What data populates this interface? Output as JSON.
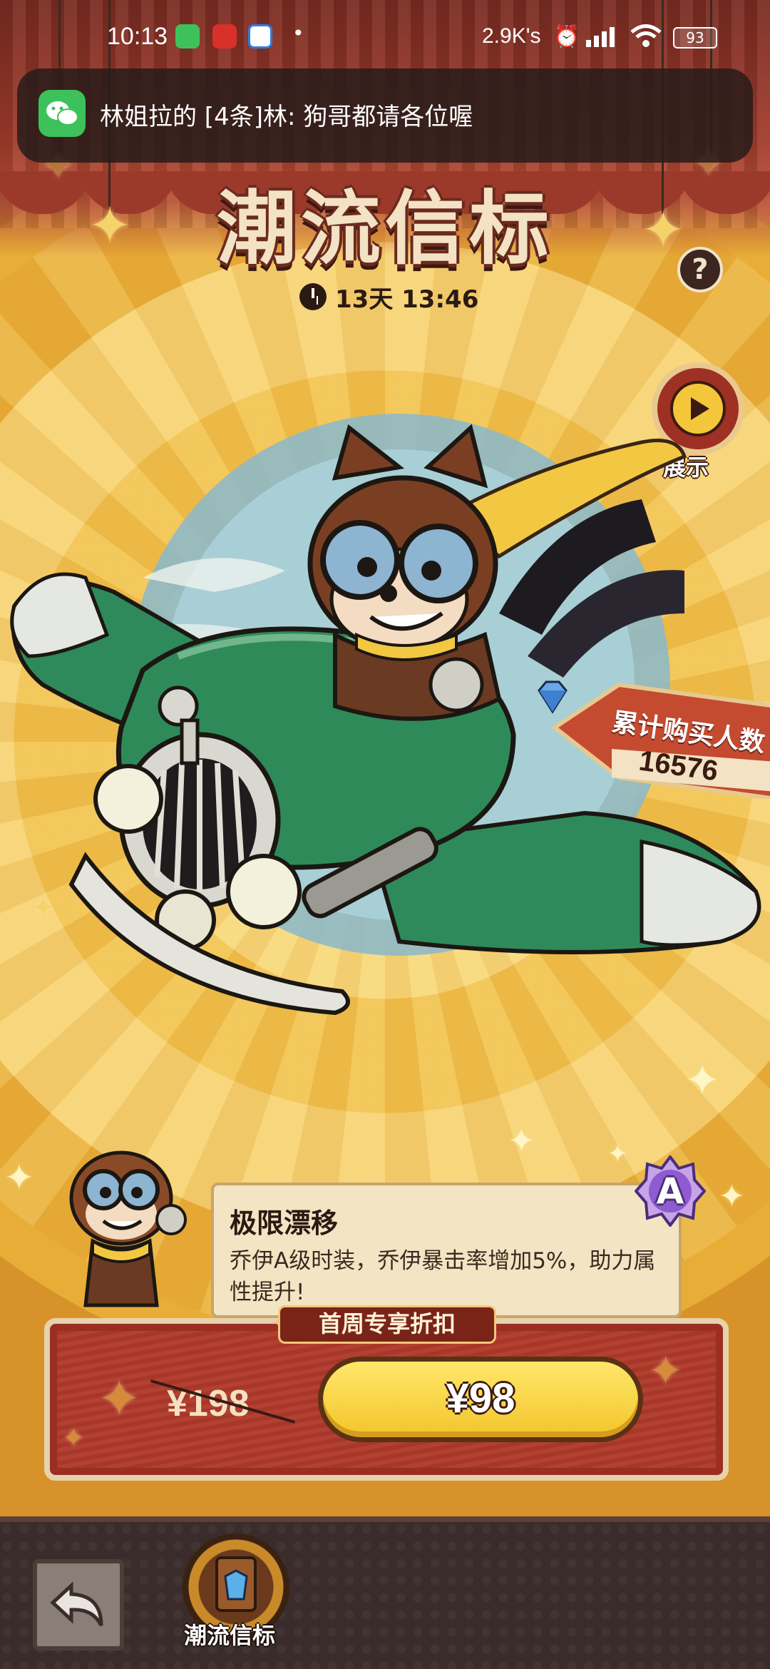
{
  "status_bar": {
    "time": "10:13",
    "dot": "•",
    "network_speed": "2.9K's",
    "battery": "93",
    "icons": [
      "wechat-icon",
      "red-app-icon",
      "qq-browser-icon",
      "alarm-icon",
      "signal-icon",
      "wifi-icon"
    ]
  },
  "notification": {
    "text": "林姐拉的 [4条]林: 狗哥都请各位喔",
    "app_icon": "wechat-icon"
  },
  "header": {
    "title": "潮流信标",
    "help_label": "?",
    "countdown": "13天  13:46"
  },
  "showcase": {
    "label": "展示"
  },
  "purchase_counter": {
    "label": "累计购买人数",
    "value": "16576"
  },
  "item": {
    "name": "极限漂移",
    "description": "乔伊A级时装，乔伊暴击率增加5%，助力属性提升!",
    "grade": "A"
  },
  "pricing": {
    "promo_label": "首周专享折扣",
    "original_price": "¥198",
    "sale_price": "¥98"
  },
  "bottom_nav": {
    "back_icon": "back-arrow-icon",
    "tab_label": "潮流信标"
  },
  "colors": {
    "accent_yellow": "#f3c52b",
    "panel_red": "#b13a2b",
    "wechat_green": "#3dc25b"
  }
}
